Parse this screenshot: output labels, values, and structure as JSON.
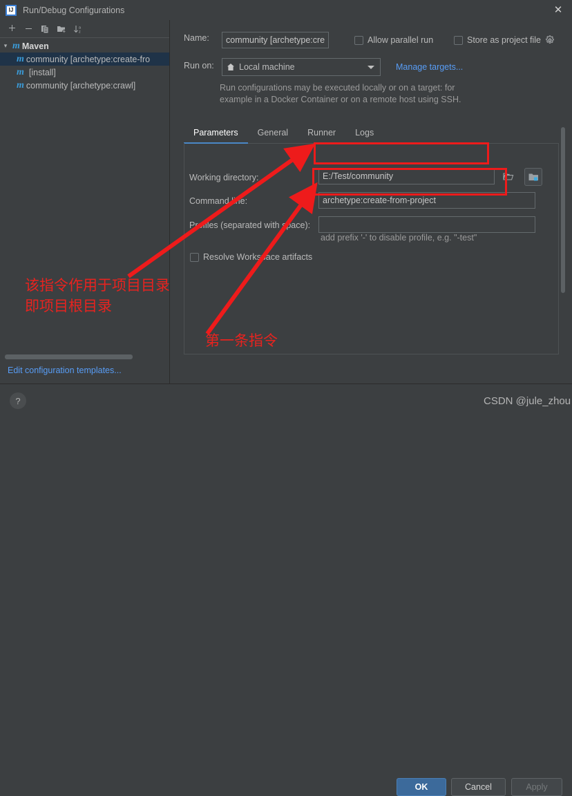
{
  "window": {
    "title": "Run/Debug Configurations",
    "app_icon": "intellij-idea-icon",
    "close_label": "✕"
  },
  "sidebar": {
    "toolbar": [
      {
        "name": "add-configuration-button",
        "icon": "plus-icon",
        "label": "+"
      },
      {
        "name": "remove-configuration-button",
        "icon": "minus-icon",
        "label": "−"
      },
      {
        "name": "copy-configuration-button",
        "icon": "copy-icon",
        "label": ""
      },
      {
        "name": "new-folder-button",
        "icon": "new-folder-icon",
        "label": ""
      },
      {
        "name": "sort-configurations-button",
        "icon": "sort-az-icon",
        "label": ""
      }
    ],
    "tree": [
      {
        "label": "Maven",
        "icon": "maven-icon",
        "level": 0,
        "expanded": true,
        "selected": false
      },
      {
        "label": "community [archetype:create-fro",
        "icon": "maven-icon",
        "level": 1,
        "expanded": null,
        "selected": true
      },
      {
        "label": "[install]",
        "icon": "maven-icon",
        "level": 1,
        "expanded": null,
        "selected": false
      },
      {
        "label": "community [archetype:crawl]",
        "icon": "maven-icon",
        "level": 1,
        "expanded": null,
        "selected": false
      }
    ],
    "edit_templates_link": "Edit configuration templates..."
  },
  "form": {
    "name_label": "Name:",
    "name_value": "community [archetype:cre",
    "allow_parallel_run_label": "Allow parallel run",
    "allow_parallel_run_checked": false,
    "store_as_project_file_label": "Store as project file",
    "store_as_project_file_checked": false,
    "store_gear_icon": "gear-icon",
    "run_on_label": "Run on:",
    "run_on_value": "Local machine",
    "run_on_icon": "home-icon",
    "manage_targets_link": "Manage targets...",
    "run_on_hint_line1": "Run configurations may be executed locally or on a target: for",
    "run_on_hint_line2": "example in a Docker Container or on a remote host using SSH."
  },
  "tabs": [
    {
      "label": "Parameters",
      "active": true
    },
    {
      "label": "General",
      "active": false
    },
    {
      "label": "Runner",
      "active": false
    },
    {
      "label": "Logs",
      "active": false
    }
  ],
  "parameters": {
    "working_directory_label": "Working directory:",
    "working_directory_value": "E:/Test/community",
    "working_directory_browse_icon": "folder-open-icon",
    "working_directory_module_icon": "module-folder-icon",
    "command_line_label": "Command line:",
    "command_line_value": "archetype:create-from-project",
    "profiles_label": "Profiles (separated with space):",
    "profiles_value": "",
    "profiles_hint": "add prefix '-' to disable profile, e.g. \"-test\"",
    "resolve_workspace_label": "Resolve Workspace artifacts",
    "resolve_workspace_checked": false
  },
  "footer": {
    "help_label": "?",
    "ok_label": "OK",
    "cancel_label": "Cancel",
    "apply_label": "Apply"
  },
  "annotations": [
    {
      "name": "annotation-working-directory",
      "text_line1": "该指令作用于项目目录",
      "text_line2": "即项目根目录"
    },
    {
      "name": "annotation-command-line",
      "text_line1": "第一条指令",
      "text_line2": ""
    }
  ],
  "watermark": "CSDN @jule_zhou",
  "colors": {
    "background": "#3c3f41",
    "selection": "#1f3348",
    "accent_link": "#589df6",
    "annotation_red": "#ee1b1b",
    "primary_button": "#3c6a9b",
    "maven_icon": "#3b9cd9"
  }
}
